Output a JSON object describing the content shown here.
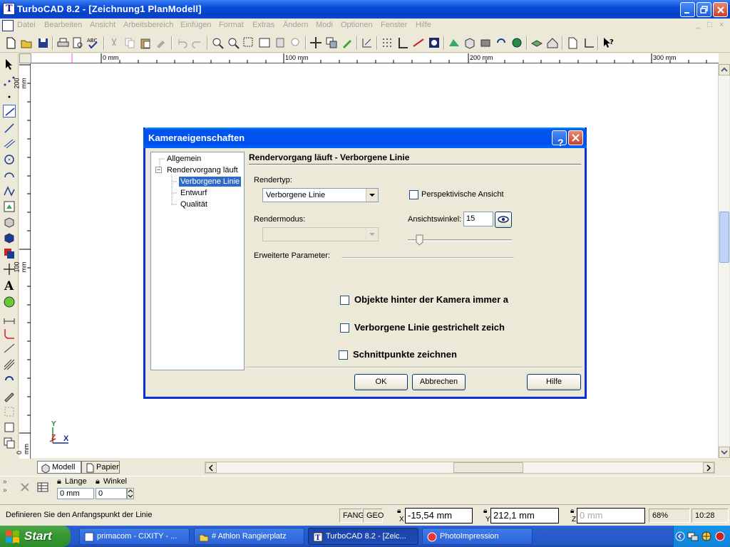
{
  "window": {
    "title": "TurboCAD 8.2 - [Zeichnung1 PlanModell]"
  },
  "menu": {
    "items": [
      "Datei",
      "Bearbeiten",
      "Ansicht",
      "Arbeitsbereich",
      "Einfügen",
      "Format",
      "Extras",
      "Ändern",
      "Modi",
      "Optionen",
      "Fenster",
      "Hilfe"
    ]
  },
  "ruler": {
    "h_labels": [
      "0 mm",
      "100 mm",
      "200 mm",
      "300 mm"
    ],
    "v_labels": [
      "200 mm",
      "100 mm",
      "0 mm"
    ]
  },
  "axis": {
    "y": "Y",
    "x": "X",
    "z": "Z"
  },
  "tabs": {
    "model": "Modell",
    "paper": "Papier"
  },
  "inspector": {
    "length_label": "Länge",
    "length_value": "0 mm",
    "angle_label": "Winkel",
    "angle_value": "0"
  },
  "status": {
    "prompt": "Definieren Sie den Anfangspunkt der Linie",
    "fang": "FANG",
    "geo": "GEO",
    "x_label": "X",
    "x_value": "-15,54 mm",
    "y_label": "Y",
    "y_value": "212,1 mm",
    "z_label": "Z",
    "z_value": "0 mm",
    "zoom": "68%",
    "time": "10:28"
  },
  "taskbar": {
    "start": "Start",
    "tasks": [
      "primacom - CIXITY - ...",
      "# Athlon Rangierplatz",
      "TurboCAD 8.2 - [Zeic...",
      "PhotoImpression"
    ]
  },
  "dialog": {
    "title": "Kameraeigenschaften",
    "help_glyph": "?",
    "tree": [
      "Allgemein",
      "Rendervorgang läuft",
      "Verborgene Linie",
      "Entwurf",
      "Qualität"
    ],
    "tree_expander": "−",
    "panel_title": "Rendervorgang läuft - Verborgene Linie",
    "rendertyp_label": "Rendertyp:",
    "rendertyp_value": "Verborgene Linie",
    "perspective_label": "Perspektivische Ansicht",
    "rendermodus_label": "Rendermodus:",
    "rendermodus_value": "",
    "viewangle_label": "Ansichtswinkel:",
    "viewangle_value": "15",
    "viewangle_slider": 0.08,
    "advanced_label": "Erweiterte Parameter:",
    "opt1": "Objekte hinter der Kamera immer a",
    "opt2": "Verborgene Linie gestrichelt zeich",
    "opt3": "Schnittpunkte zeichnen",
    "ok": "OK",
    "cancel": "Abbrechen",
    "help": "Hilfe"
  },
  "colors": {
    "titlebar": "#0a4cd8",
    "selection": "#316ac5",
    "taskbar": "#2457c6",
    "start": "#379a33"
  }
}
